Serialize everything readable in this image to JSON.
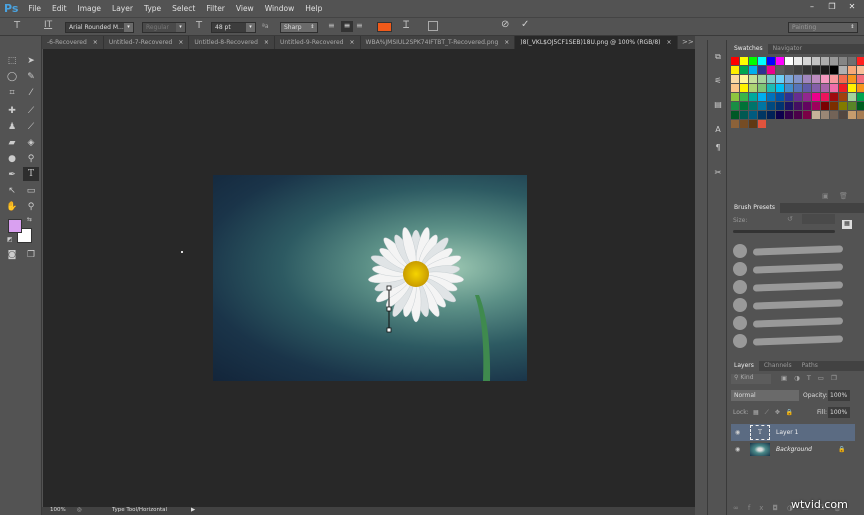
{
  "app": {
    "logo": "Ps",
    "menu": [
      "File",
      "Edit",
      "Image",
      "Layer",
      "Type",
      "Select",
      "Filter",
      "View",
      "Window",
      "Help"
    ],
    "window_controls": [
      "–",
      "❐",
      "✕"
    ]
  },
  "options": {
    "font_family": "Arial Rounded M...",
    "font_style": "Regular",
    "font_size": "48 pt",
    "antialias": "Sharp",
    "text_color": "#f05a1a",
    "workspace": "Painting",
    "cancel_icon": "⃠",
    "commit_icon": "✓"
  },
  "tabs": [
    {
      "label": "-6-Recovered"
    },
    {
      "label": "Untitled-7-Recovered"
    },
    {
      "label": "Untitled-8-Recovered"
    },
    {
      "label": "Untitled-9-Recovered"
    },
    {
      "label": "WBA%JMSIUL2SPK74IFTBT_T-Recovered.png"
    },
    {
      "label": ")8(_VKL$OJ5CF1SEB)18U.png @ 100% (RGB/8)",
      "active": true
    }
  ],
  "tabs_overflow": ">>",
  "tools": {
    "foreground": "#d9a0f0",
    "background": "#ffffff"
  },
  "status": {
    "zoom": "100%",
    "info": "Type Tool/Horizontal"
  },
  "swatches": {
    "tabs": [
      "Swatches",
      "Navigator"
    ],
    "colors": [
      "#ff0000",
      "#ffff00",
      "#00ff00",
      "#00ffff",
      "#0000ff",
      "#ff00ff",
      "#ffffff",
      "#ebebeb",
      "#d6d6d6",
      "#c2c2c2",
      "#adadad",
      "#999999",
      "#858585",
      "#707070",
      "#ff2020",
      "#ffee00",
      "#00a650",
      "#00aeef",
      "#2e3192",
      "#ec008c",
      "#5c5c5c",
      "#4d4d4d",
      "#404040",
      "#333333",
      "#262626",
      "#1a1a1a",
      "#000000",
      "#b0b0b0",
      "#f7a97a",
      "#f9c09a",
      "#fbd9a4",
      "#fff799",
      "#c4df9b",
      "#a3d39c",
      "#7accc8",
      "#6dcff6",
      "#7da7d9",
      "#8393ca",
      "#a186be",
      "#bd8cbf",
      "#f49ac1",
      "#f5989d",
      "#f26c4f",
      "#f7941d",
      "#f26d7d",
      "#fdc689",
      "#fff200",
      "#acd373",
      "#7cc576",
      "#1cbbb4",
      "#00bff3",
      "#448ccb",
      "#5674b9",
      "#605ca8",
      "#855fa8",
      "#a864a8",
      "#f06eaa",
      "#ed1c24",
      "#fff200",
      "#f7941d",
      "#8dc63f",
      "#39b54a",
      "#00a99d",
      "#00aeef",
      "#0072bc",
      "#0054a6",
      "#2e3192",
      "#662d91",
      "#92278f",
      "#ec008c",
      "#ed145b",
      "#9e0b0f",
      "#a0410d",
      "#a3d39c",
      "#00a651",
      "#198d45",
      "#007236",
      "#00746b",
      "#0076a3",
      "#004a80",
      "#003471",
      "#1b1464",
      "#440e62",
      "#630460",
      "#9e005d",
      "#790000",
      "#7b2e00",
      "#827b00",
      "#598527",
      "#005e20",
      "#005826",
      "#005952",
      "#005b7f",
      "#003663",
      "#002157",
      "#0d004c",
      "#32004b",
      "#4b0049",
      "#7b0046",
      "#c7b299",
      "#998675",
      "#736357",
      "#534741",
      "#c69c6d",
      "#a67c52",
      "#8c6239",
      "#754c24",
      "#603913",
      "#e0533d"
    ]
  },
  "brush_presets": {
    "title": "Brush Presets",
    "size_label": "Size:"
  },
  "layers": {
    "tabs": [
      "Layers",
      "Channels",
      "Paths"
    ],
    "kind": "Kind",
    "blend_mode": "Normal",
    "opacity_label": "Opacity:",
    "opacity": "100%",
    "lock_label": "Lock:",
    "fill_label": "Fill:",
    "fill": "100%",
    "items": [
      {
        "name": "Layer 1",
        "type": "text",
        "selected": true
      },
      {
        "name": "Background",
        "type": "image",
        "locked": true
      }
    ]
  },
  "watermark": "wtvid.com"
}
